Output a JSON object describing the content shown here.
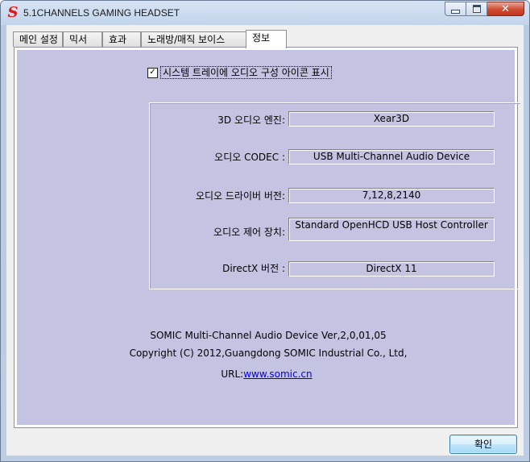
{
  "window": {
    "title": "5.1CHANNELS GAMING HEADSET",
    "logo_letter": "S",
    "buttons": {
      "minimize": "minimize",
      "maximize": "maximize",
      "close_glyph": "✕"
    }
  },
  "tabs": [
    {
      "label": "메인 설정",
      "active": false
    },
    {
      "label": "믹서",
      "active": false
    },
    {
      "label": "효과",
      "active": false
    },
    {
      "label": "노래방/매직 보이스",
      "active": false
    },
    {
      "label": "정보",
      "active": true
    }
  ],
  "info_tab": {
    "tray_checkbox": {
      "label": "시스템 트레이에 오디오 구성 아이콘 표시",
      "checked": true,
      "check_glyph": "✓"
    },
    "fields": [
      {
        "label": "3D 오디오 엔진:",
        "value": "Xear3D"
      },
      {
        "label": "오디오 CODEC :",
        "value": "USB Multi-Channel Audio Device"
      },
      {
        "label": "오디오 드라이버 버전:",
        "value": "7,12,8,2140"
      },
      {
        "label": "오디오 제어 장치:",
        "value": "Standard OpenHCD USB Host Controller"
      },
      {
        "label": "DirectX 버전 :",
        "value": "DirectX 11"
      }
    ],
    "version_line": "SOMIC Multi-Channel Audio Device Ver,2,0,01,05",
    "copyright_line": "Copyright (C) 2012,Guangdong SOMIC Industrial Co.,  Ltd,",
    "url_label": "URL:",
    "url_text": "www.somic.cn"
  },
  "footer": {
    "ok_label": "확인"
  },
  "colors": {
    "panel": "#c4c4e2",
    "logo": "#e01515",
    "link": "#0000ee",
    "close_button": "#cf4a32"
  }
}
